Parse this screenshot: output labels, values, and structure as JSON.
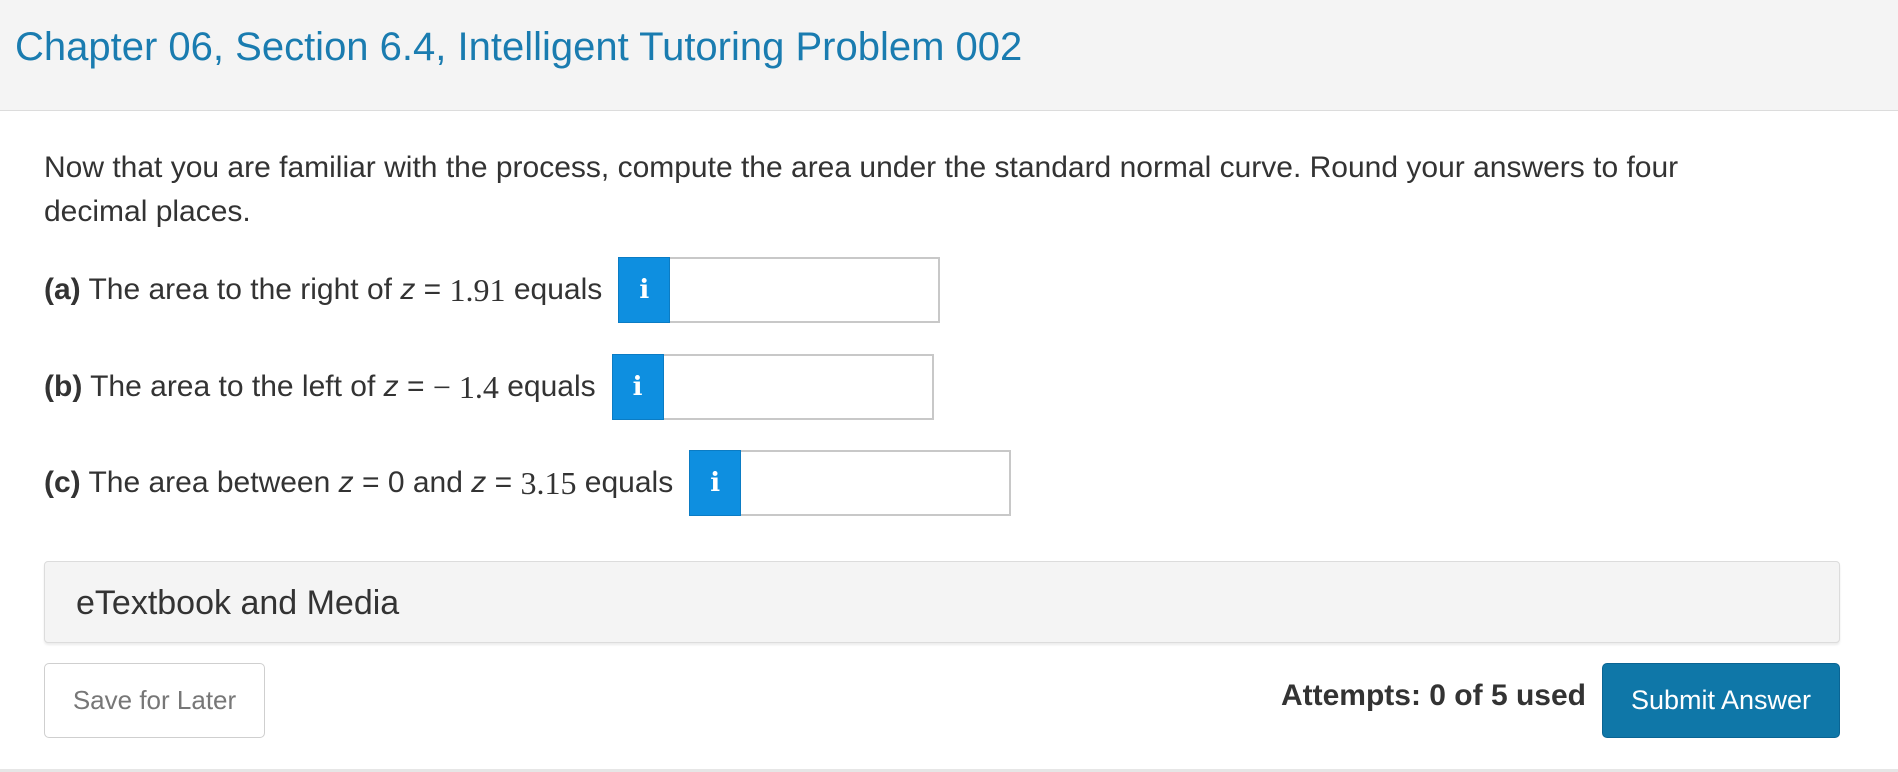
{
  "header": {
    "title": "Chapter 06, Section 6.4, Intelligent Tutoring Problem 002"
  },
  "intro": "Now that you are familiar with the process, compute the area under the standard normal curve. Round your answers to four decimal places.",
  "questions": [
    {
      "letter": "(a)",
      "text_before": " The area to the right of ",
      "var1": "z",
      "eq1": " = ",
      "val1": "1.91",
      "text_mid": "",
      "var2": "",
      "eq2": "",
      "val2": "",
      "text_after": " equals",
      "info_icon": "i",
      "answer_value": ""
    },
    {
      "letter": "(b)",
      "text_before": " The area to the left of ",
      "var1": "z",
      "eq1": " = ",
      "val1": "− 1.4",
      "text_mid": "",
      "var2": "",
      "eq2": "",
      "val2": "",
      "text_after": " equals",
      "info_icon": "i",
      "answer_value": ""
    },
    {
      "letter": "(c)",
      "text_before": " The area between ",
      "var1": "z",
      "eq1": " = ",
      "val1": "0",
      "text_mid": " and ",
      "var2": "z",
      "eq2": " = ",
      "val2": "3.15",
      "text_after": " equals",
      "info_icon": "i",
      "answer_value": ""
    }
  ],
  "etextbook": {
    "label": "eTextbook and Media"
  },
  "footer": {
    "save_label": "Save for Later",
    "attempts_text": "Attempts: 0 of 5 used",
    "submit_label": "Submit Answer"
  },
  "colors": {
    "title": "#1a7cb0",
    "info_button": "#0e8fe0",
    "submit_button": "#0f77a8",
    "header_bg": "#f4f4f4"
  }
}
